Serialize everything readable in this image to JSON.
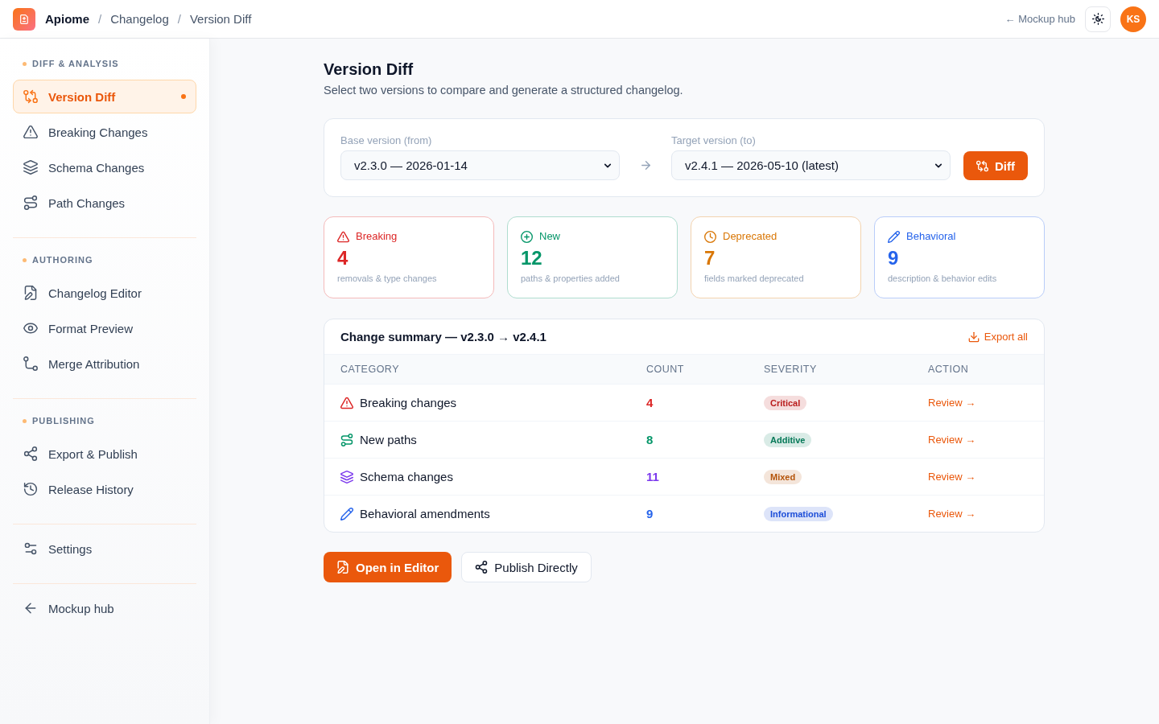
{
  "header": {
    "app_name": "Apiome",
    "breadcrumb": [
      {
        "separator": "/",
        "label": "Changelog"
      },
      {
        "separator": "/",
        "label": "Version Diff"
      }
    ],
    "back_link": "← Mockup hub",
    "avatar": "KS"
  },
  "sidebar": {
    "sections": [
      {
        "label": "DIFF & ANALYSIS",
        "items": [
          {
            "label": "Version Diff",
            "selected": true
          },
          {
            "label": "Breaking Changes",
            "selected": false
          },
          {
            "label": "Schema Changes",
            "selected": false
          },
          {
            "label": "Path Changes",
            "selected": false
          }
        ]
      },
      {
        "label": "AUTHORING",
        "items": [
          {
            "label": "Changelog Editor",
            "selected": false
          },
          {
            "label": "Format Preview",
            "selected": false
          },
          {
            "label": "Merge Attribution",
            "selected": false
          }
        ]
      },
      {
        "label": "PUBLISHING",
        "items": [
          {
            "label": "Export & Publish",
            "selected": false
          },
          {
            "label": "Release History",
            "selected": false
          }
        ]
      },
      {
        "items": [
          {
            "label": "Settings",
            "selected": false
          }
        ]
      },
      {
        "items": [
          {
            "label": "Mockup hub",
            "selected": false
          }
        ]
      }
    ]
  },
  "page": {
    "title": "Version Diff",
    "subtitle": "Select two versions to compare and generate a structured changelog."
  },
  "version_picker": {
    "base": {
      "label": "Base version (from)",
      "value": "v2.3.0 — 2026-01-14"
    },
    "target": {
      "label": "Target version (to)",
      "value": "v2.4.1 — 2026-05-10 (latest)"
    },
    "button": "Diff"
  },
  "stats": [
    {
      "label": "Breaking",
      "value": "4",
      "description": "removals & type changes",
      "color": "#dc2626"
    },
    {
      "label": "New",
      "value": "12",
      "description": "paths & properties added",
      "color": "#059669"
    },
    {
      "label": "Deprecated",
      "value": "7",
      "description": "fields marked deprecated",
      "color": "#d97706"
    },
    {
      "label": "Behavioral",
      "value": "9",
      "description": "description & behavior edits",
      "color": "#2563eb"
    }
  ],
  "summary": {
    "title": "Change summary — v2.3.0 → v2.4.1",
    "export": "Export all",
    "columns": [
      "CATEGORY",
      "COUNT",
      "SEVERITY",
      "ACTION"
    ],
    "rows": [
      {
        "category": "Breaking changes",
        "count": "4",
        "color": "#dc2626",
        "severity": {
          "label": "Critical",
          "color": "#b91c1c"
        },
        "action": "Review →"
      },
      {
        "category": "New paths",
        "count": "8",
        "color": "#059669",
        "severity": {
          "label": "Additive",
          "color": "#047857"
        },
        "action": "Review →"
      },
      {
        "category": "Schema changes",
        "count": "11",
        "color": "#7c3aed",
        "severity": {
          "label": "Mixed",
          "color": "#b45309"
        },
        "action": "Review →"
      },
      {
        "category": "Behavioral amendments",
        "count": "9",
        "color": "#2563eb",
        "severity": {
          "label": "Informational",
          "color": "#1d4ed8"
        },
        "action": "Review →"
      }
    ]
  },
  "actions": [
    {
      "label": "Open in Editor",
      "kind": "primary"
    },
    {
      "label": "Publish Directly",
      "kind": "secondary"
    }
  ]
}
